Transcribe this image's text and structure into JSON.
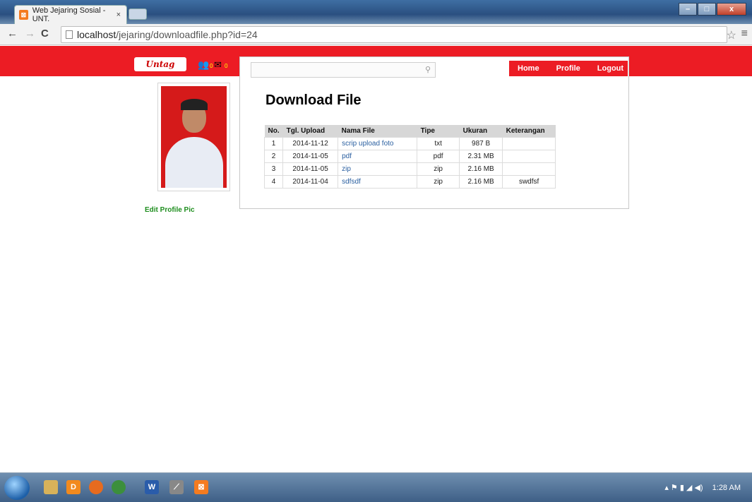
{
  "browser": {
    "tab_title": "Web Jejaring Sosial - UNT.",
    "tab_close": "×",
    "url_host": "localhost",
    "url_path": "/jejaring/downloadfile.php?id=24"
  },
  "site": {
    "logo_text": "Untag",
    "notif_friends": "0",
    "notif_messages": "0"
  },
  "nav": {
    "home": "Home",
    "profile": "Profile",
    "logout": "Logout"
  },
  "search": {
    "placeholder": ""
  },
  "sidebar": {
    "edit_profile_pic": "Edit Profile Pic"
  },
  "main": {
    "title": "Download File",
    "table": {
      "headers": [
        "No.",
        "Tgl. Upload",
        "Nama File",
        "Tipe",
        "Ukuran",
        "Keterangan"
      ],
      "rows": [
        {
          "no": "1",
          "tgl": "2014-11-12",
          "nama": "scrip upload foto",
          "tipe": "txt",
          "ukuran": "987 B",
          "ket": ""
        },
        {
          "no": "2",
          "tgl": "2014-11-05",
          "nama": "pdf",
          "tipe": "pdf",
          "ukuran": "2.31 MB",
          "ket": ""
        },
        {
          "no": "3",
          "tgl": "2014-11-05",
          "nama": "zip",
          "tipe": "zip",
          "ukuran": "2.16 MB",
          "ket": ""
        },
        {
          "no": "4",
          "tgl": "2014-11-04",
          "nama": "sdfsdf",
          "tipe": "zip",
          "ukuran": "2.16 MB",
          "ket": "swdfsf"
        }
      ]
    }
  },
  "taskbar": {
    "clock": "1:28 AM"
  }
}
